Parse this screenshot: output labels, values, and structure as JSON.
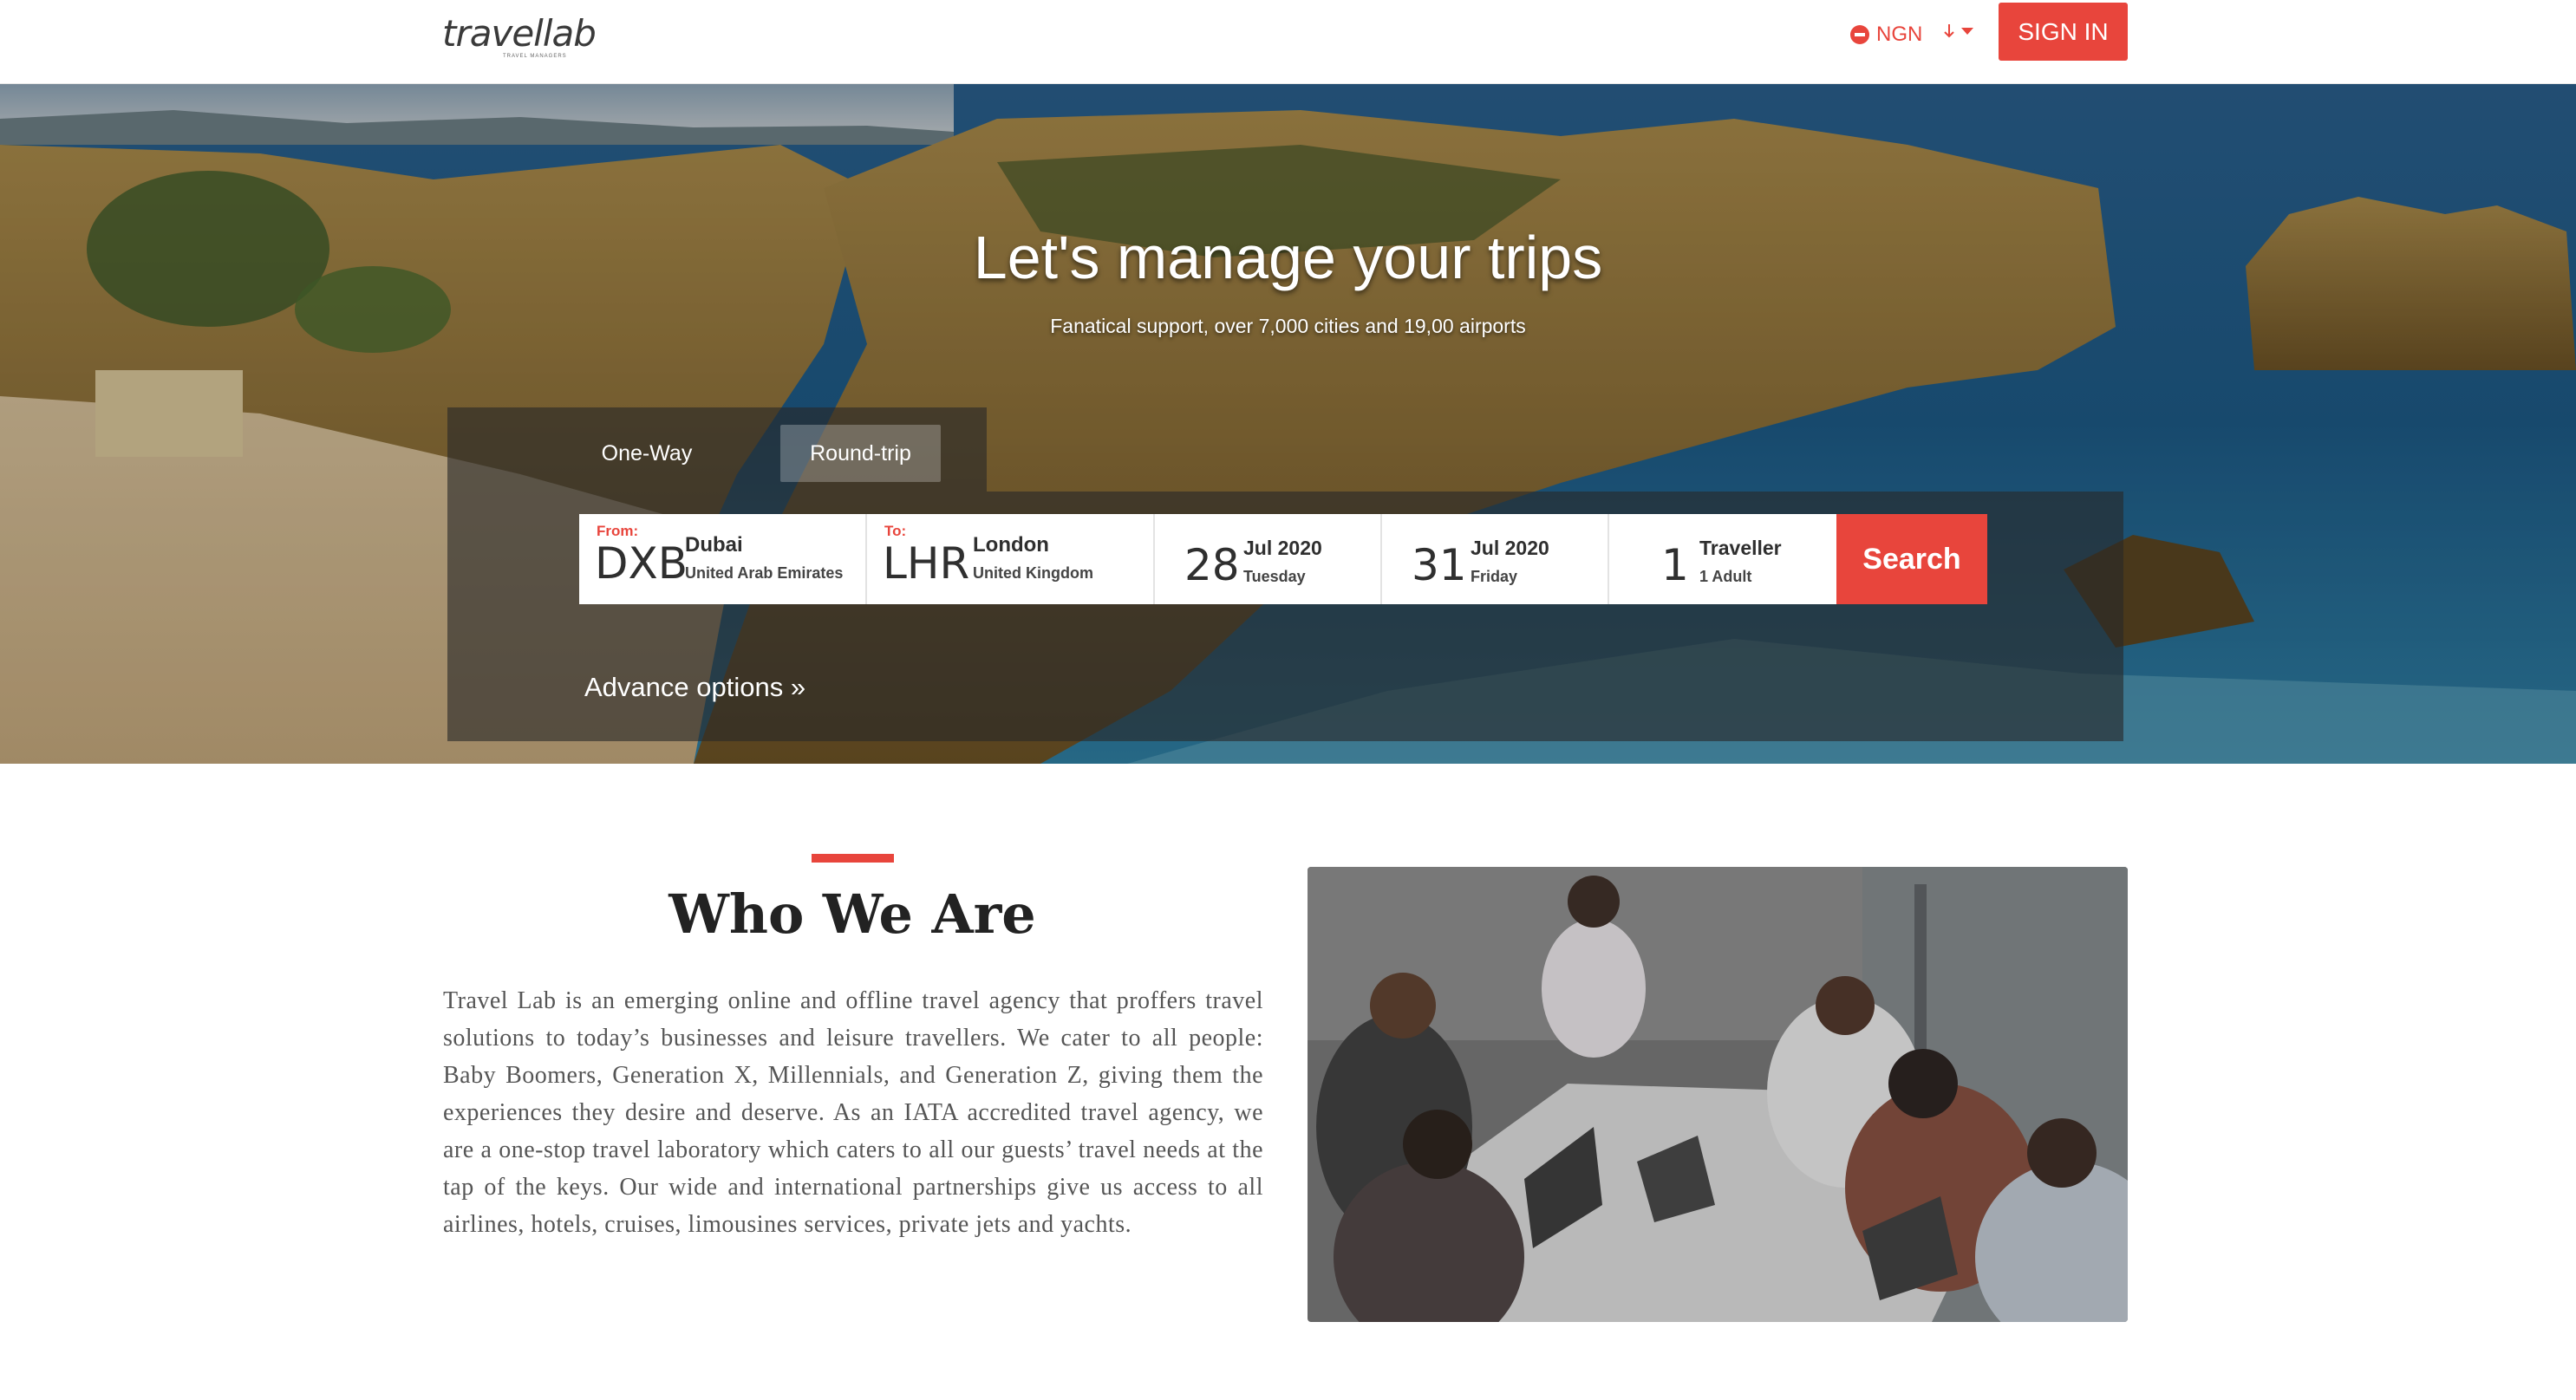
{
  "header": {
    "logo_text": "travellab",
    "logo_tagline": "TRAVEL MANAGERS",
    "currency": "NGN",
    "signin_label": "SIGN IN"
  },
  "hero": {
    "title": "Let's manage your trips",
    "subtitle": "Fanatical support, over 7,000 cities and 19,00 airports"
  },
  "search": {
    "tabs": [
      {
        "label": "One-Way",
        "active": false
      },
      {
        "label": "Round-trip",
        "active": true
      }
    ],
    "from": {
      "label": "From:",
      "code": "DXB",
      "city": "Dubai",
      "country": "United Arab Emirates"
    },
    "to": {
      "label": "To:",
      "code": "LHR",
      "city": "London",
      "country": "United Kingdom"
    },
    "depart": {
      "day": "28",
      "month": "Jul 2020",
      "weekday": "Tuesday"
    },
    "return": {
      "day": "31",
      "month": "Jul 2020",
      "weekday": "Friday"
    },
    "travellers": {
      "count": "1",
      "label": "Traveller",
      "detail": "1 Adult"
    },
    "search_label": "Search",
    "advance_label": "Advance options »"
  },
  "about": {
    "title": "Who We Are",
    "body": "Travel Lab is an emerging online and offline travel agency that proffers travel solutions to today’s businesses and leisure travellers. We cater to all people: Baby Boomers, Generation X, Millennials, and Generation Z, giving them the experiences they desire and deserve. As an IATA accredited travel agency, we are a one-stop travel laboratory which caters to all our guests’ travel needs at the tap of the keys. Our wide and international partnerships give us access to all airlines, hotels, cruises, limousines services, private jets and yachts."
  },
  "colors": {
    "accent": "#e8453c",
    "panel": "rgba(40,40,40,0.62)"
  }
}
